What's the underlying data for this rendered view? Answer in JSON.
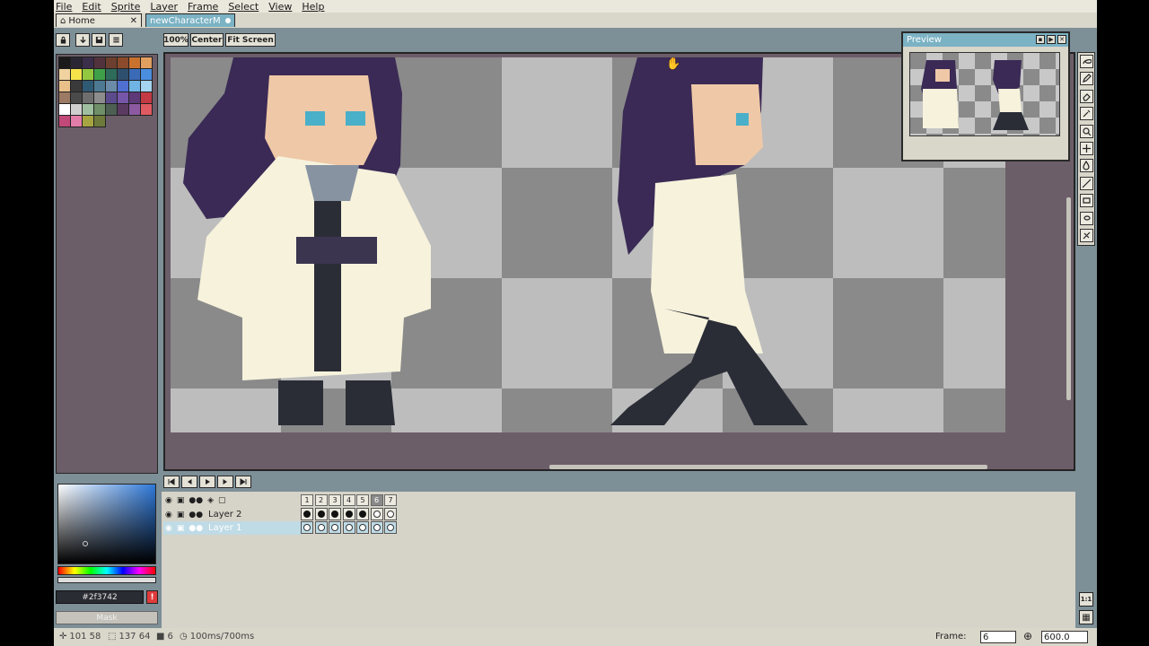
{
  "menu": [
    "File",
    "Edit",
    "Sprite",
    "Layer",
    "Frame",
    "Select",
    "View",
    "Help"
  ],
  "tabs": {
    "home": "Home",
    "file": "newCharacterM",
    "close_glyph": "✕"
  },
  "toolbar": {
    "zoom": "100%",
    "center": "Center",
    "fit": "Fit Screen"
  },
  "palette": {
    "colors": [
      "#1a1a1a",
      "#2b2633",
      "#3b2e4a",
      "#52323c",
      "#6c3f2e",
      "#8a4a2b",
      "#c9722e",
      "#e1a060",
      "#f0d3a0",
      "#f6e34a",
      "#93c940",
      "#3fa04a",
      "#2e6b5a",
      "#2f4f6e",
      "#3b6bb7",
      "#4b8ee0",
      "#e9c08a",
      "#3a3a3a",
      "#2f5a74",
      "#4d7a92",
      "#6b8ca9",
      "#4f6fd1",
      "#6fb4e3",
      "#a5d4f0",
      "#9c7a63",
      "#4a4a4a",
      "#6e6e6e",
      "#8d8d8d",
      "#5b4b8c",
      "#7656a8",
      "#5e3a78",
      "#c33a44",
      "#ffffff",
      "#cfcfcf",
      "#9fbfa0",
      "#6e8f67",
      "#4c5f52",
      "#5b3a62",
      "#8c5aa0",
      "#e05a62",
      "#c0497a",
      "#e27ca8",
      "#a7a442",
      "#6e7a3b"
    ]
  },
  "color": {
    "hex": "#2f3742",
    "alert": "!",
    "mask": "Mask"
  },
  "preview": {
    "title": "Preview"
  },
  "timeline": {
    "frames": [
      "1",
      "2",
      "3",
      "4",
      "5",
      "6",
      "7"
    ],
    "current_frame_index": 5,
    "layers": [
      {
        "name": "Layer 2",
        "cels": [
          "filled",
          "filled",
          "filled",
          "filled",
          "filled",
          "hollow",
          "hollow"
        ],
        "selected": false
      },
      {
        "name": "Layer 1",
        "cels": [
          "hollow",
          "hollow",
          "hollow",
          "hollow",
          "hollow",
          "hollow",
          "hollow"
        ],
        "selected": true
      }
    ]
  },
  "right_buttons": {
    "one_to_one": "1:1"
  },
  "status": {
    "cursor": "101 58",
    "size": "137 64",
    "frame_count": "6",
    "duration": "100ms/700ms",
    "frame_label": "Frame:",
    "frame_value": "6",
    "zoom_value": "600.0"
  }
}
